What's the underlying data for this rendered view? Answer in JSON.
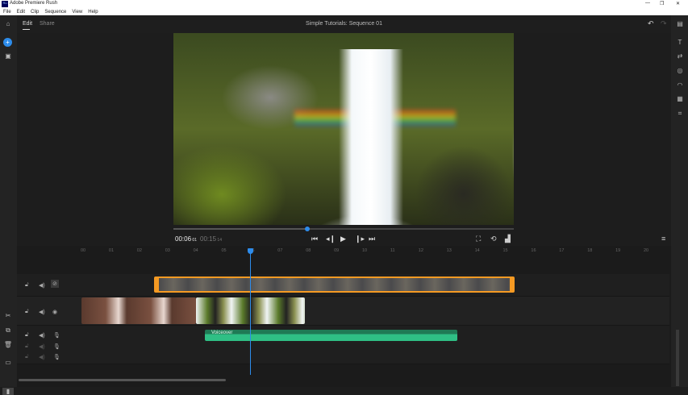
{
  "window": {
    "title": "Adobe Premiere Rush",
    "app_icon": "Ru",
    "controls": [
      "—",
      "❐",
      "✕"
    ]
  },
  "menu": [
    "File",
    "Edit",
    "Clip",
    "Sequence",
    "View",
    "Help"
  ],
  "tabs": [
    {
      "label": "Edit",
      "active": true
    },
    {
      "label": "Share",
      "active": false
    }
  ],
  "sequence_title": "Simple Tutorials: Sequence 01",
  "playback": {
    "current": "00:06",
    "current_frames": "01",
    "duration": "00:15",
    "duration_frames": "14",
    "progress_percent": 40
  },
  "ruler": [
    "00",
    "01",
    "02",
    "03",
    "04",
    "05",
    "06",
    "07",
    "08",
    "09",
    "10",
    "11",
    "12",
    "13",
    "14",
    "15",
    "16",
    "17",
    "18",
    "19",
    "20"
  ],
  "audio_clip": {
    "label": "Voiceover",
    "color": "#2fbf85"
  },
  "colors": {
    "accent": "#2d8ceb",
    "selection": "#f59a23"
  }
}
